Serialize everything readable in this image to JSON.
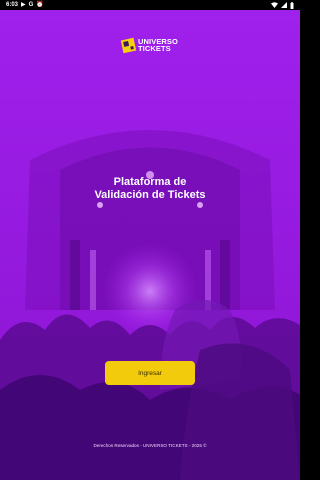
{
  "status_bar": {
    "time": "6:03",
    "indicators": [
      "play-store-icon",
      "g-icon",
      "alarm-icon"
    ],
    "system_icons": [
      "wifi-icon",
      "signal-icon",
      "battery-icon"
    ]
  },
  "logo": {
    "line1": "UNIVERSO",
    "line2": "TICKETS"
  },
  "title": {
    "line1": "Plataforma de",
    "line2": "Validación de Tickets"
  },
  "button": {
    "label": "Ingresar"
  },
  "footer": {
    "text": "Derechos Reservados - UNIVERSO TICKETS - 2025 ©"
  },
  "colors": {
    "overlay": "#9b1be0",
    "button": "#f2cc0c",
    "logo_mark": "#f5d20a"
  }
}
